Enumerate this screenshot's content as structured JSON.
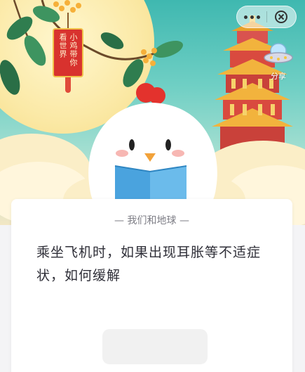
{
  "banner": {
    "tag_lines": [
      "小鸡带你",
      "看世界"
    ],
    "share_label": "分享"
  },
  "topbar": {
    "more_icon": "more-dots-icon",
    "close_icon": "close-circle-icon"
  },
  "card": {
    "section_label": "— 我们和地球 —",
    "question": "乘坐飞机时，如果出现耳胀等不适症状，如何缓解"
  },
  "colors": {
    "sky": "#6fcfc4",
    "moon": "#fbe9a6",
    "pagoda": "#e8a02a",
    "tag_red": "#d8322e",
    "question_text": "#2f2f38"
  }
}
